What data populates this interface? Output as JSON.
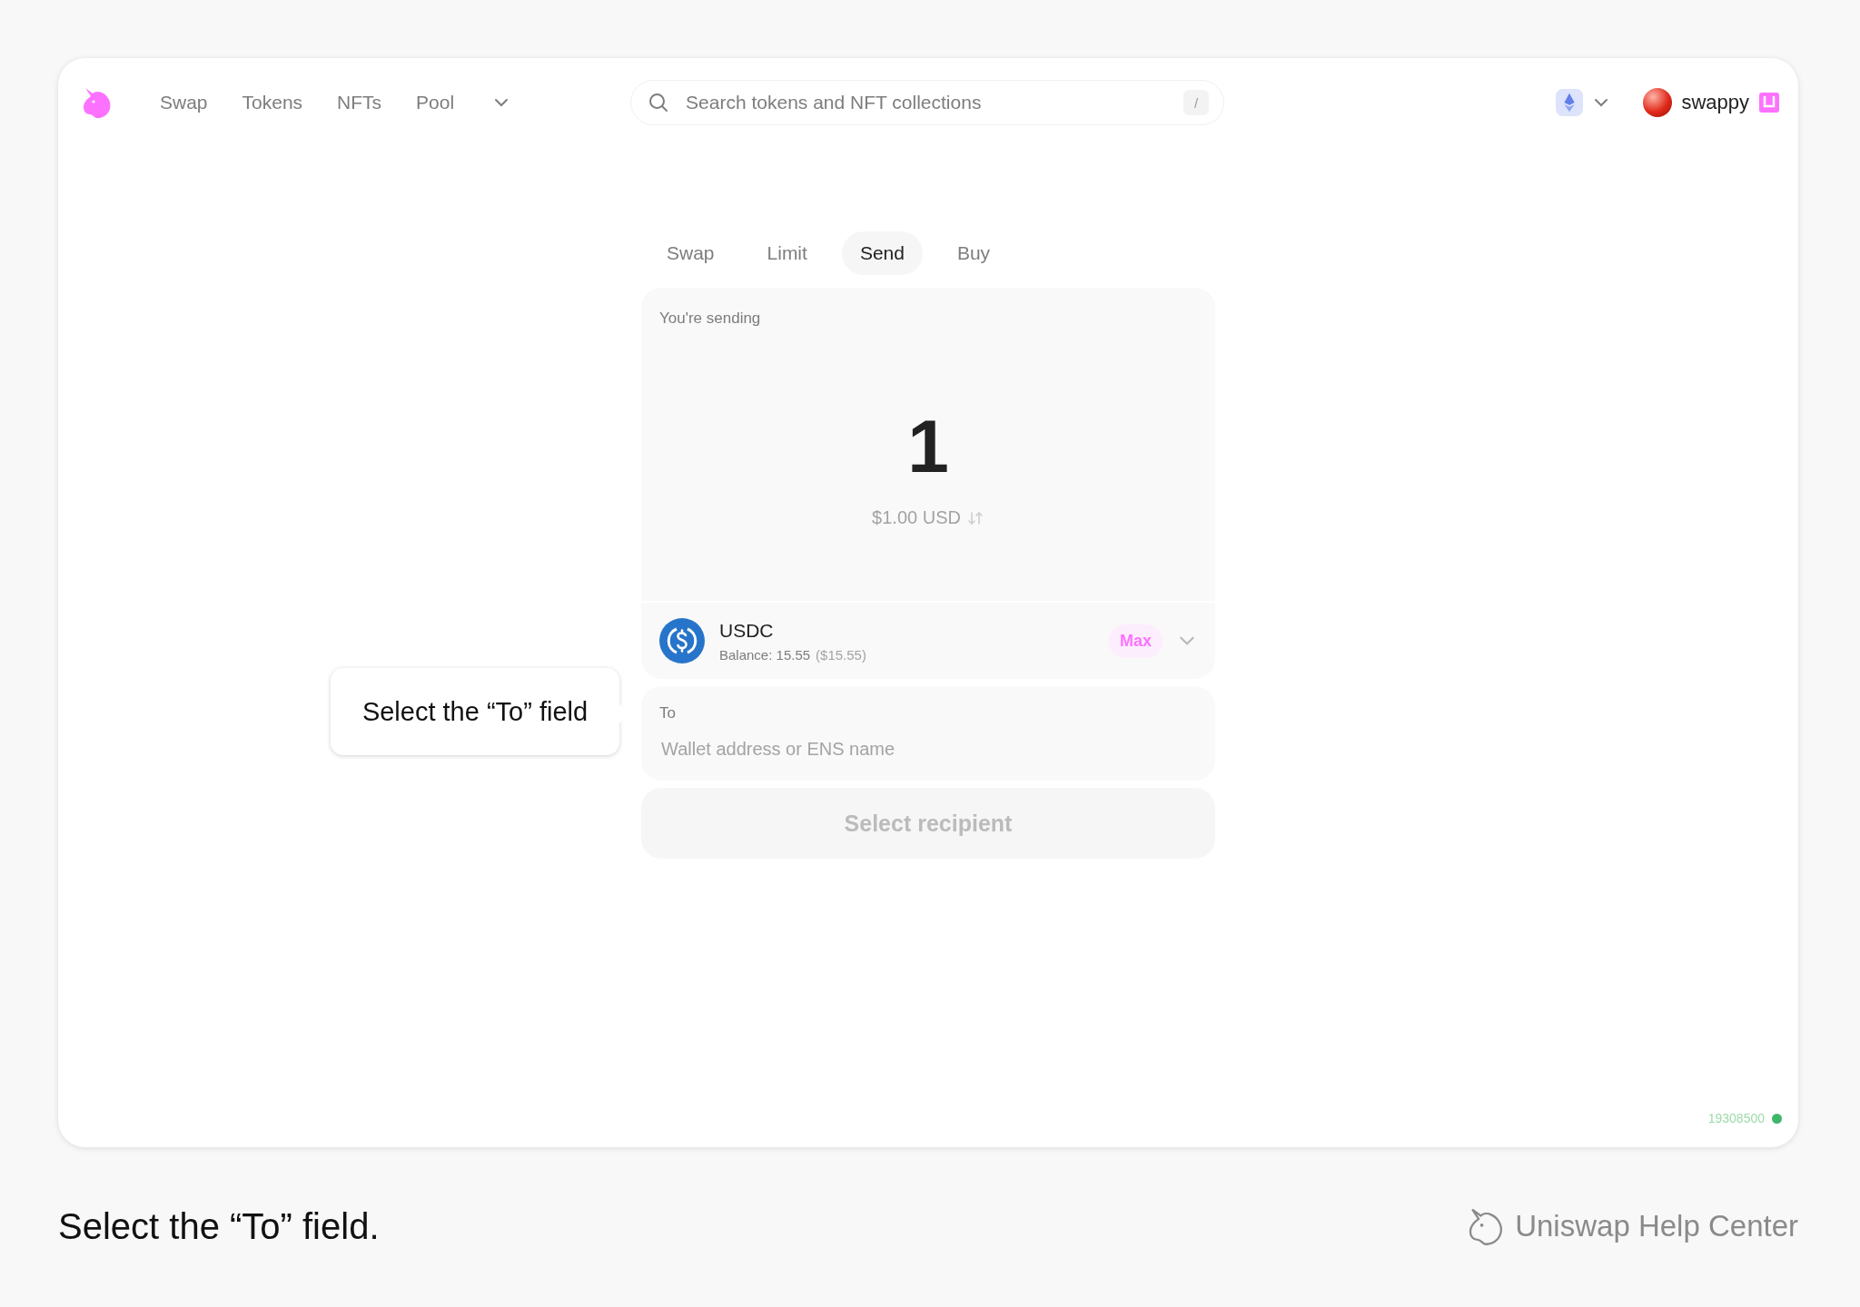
{
  "nav": {
    "links": [
      {
        "label": "Swap"
      },
      {
        "label": "Tokens"
      },
      {
        "label": "NFTs"
      },
      {
        "label": "Pool"
      }
    ],
    "search": {
      "placeholder": "Search tokens and NFT collections",
      "shortcut": "/"
    },
    "account": {
      "name": "swappy"
    }
  },
  "tabs": [
    {
      "label": "Swap",
      "selected": false
    },
    {
      "label": "Limit",
      "selected": false
    },
    {
      "label": "Send",
      "selected": true
    },
    {
      "label": "Buy",
      "selected": false
    }
  ],
  "send": {
    "label": "You're sending",
    "amount": "1",
    "fiat": "$1.00 USD",
    "token": {
      "symbol": "USDC",
      "balance": "Balance: 15.55",
      "balance_fiat": "($15.55)"
    },
    "max_button": "Max"
  },
  "to": {
    "label": "To",
    "placeholder": "Wallet address or ENS name"
  },
  "submit": {
    "label": "Select recipient",
    "disabled": true
  },
  "tooltip": "Select the “To” field",
  "block_number": "19308500",
  "caption": "Select the “To” field.",
  "brand": "Uniswap Help Center"
}
